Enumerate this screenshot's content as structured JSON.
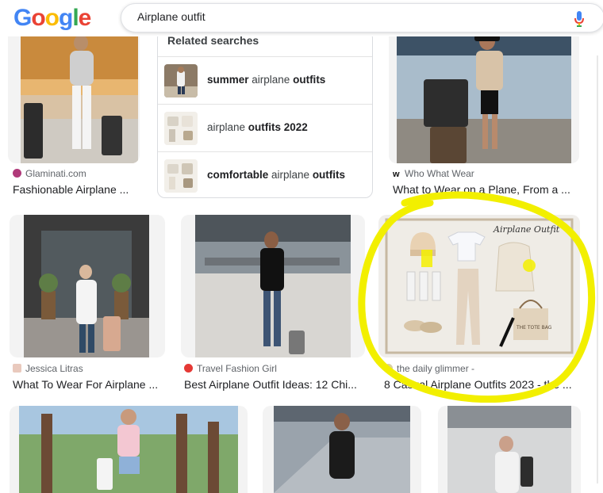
{
  "header": {
    "logo": [
      "G",
      "o",
      "o",
      "g",
      "l",
      "e"
    ],
    "search_value": "Airplane outfit",
    "colors": {
      "blue": "#4285F4",
      "red": "#EA4335",
      "yellow": "#FBBC05",
      "green": "#34A853"
    }
  },
  "related": {
    "title": "Related searches",
    "items": [
      {
        "parts": [
          {
            "t": "summer",
            "b": true
          },
          {
            "t": " airplane ",
            "b": false
          },
          {
            "t": "outfits",
            "b": true
          }
        ]
      },
      {
        "parts": [
          {
            "t": "airplane ",
            "b": false
          },
          {
            "t": "outfits 2022",
            "b": true
          }
        ]
      },
      {
        "parts": [
          {
            "t": "comfortable",
            "b": true
          },
          {
            "t": " airplane ",
            "b": false
          },
          {
            "t": "outfits",
            "b": true
          }
        ]
      }
    ]
  },
  "results": [
    {
      "source": "Glaminati.com",
      "title": "Fashionable Airplane ..."
    },
    {
      "source": "Who What Wear",
      "title": "What to Wear on a Plane, From a ..."
    },
    {
      "source": "Jessica Litras",
      "title": "What To Wear For Airplane ..."
    },
    {
      "source": "Travel Fashion Girl",
      "title": "Best Airplane Outfit Ideas: 12 Chi..."
    },
    {
      "source": "the daily glimmer -",
      "title": "8 Casual Airplane Outfits 2023 - the ..."
    }
  ],
  "collage": {
    "heading": "Airplane Outfit",
    "bag_label": "THE TOTE BAG"
  }
}
